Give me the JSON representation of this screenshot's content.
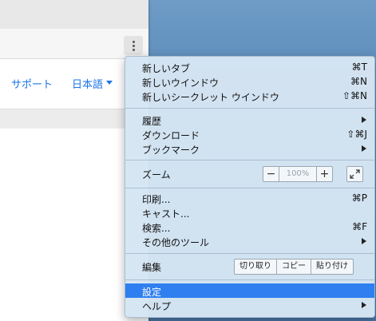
{
  "browser": {
    "nav_links": {
      "support": "サポート",
      "language": "日本語"
    }
  },
  "menu": {
    "group1": [
      {
        "label": "新しいタブ",
        "shortcut": "⌘T"
      },
      {
        "label": "新しいウインドウ",
        "shortcut": "⌘N"
      },
      {
        "label": "新しいシークレット ウインドウ",
        "shortcut": "⇧⌘N"
      }
    ],
    "group2": [
      {
        "label": "履歴",
        "shortcut": ""
      },
      {
        "label": "ダウンロード",
        "shortcut": "⇧⌘J"
      },
      {
        "label": "ブックマーク",
        "shortcut": ""
      }
    ],
    "zoom": {
      "label": "ズーム",
      "minus": "−",
      "value": "100%",
      "plus": "+"
    },
    "group3": [
      {
        "label": "印刷...",
        "shortcut": "⌘P"
      },
      {
        "label": "キャスト...",
        "shortcut": ""
      },
      {
        "label": "検索...",
        "shortcut": "⌘F"
      },
      {
        "label": "その他のツール",
        "shortcut": ""
      }
    ],
    "edit": {
      "label": "編集",
      "cut": "切り取り",
      "copy": "コピー",
      "paste": "貼り付け"
    },
    "settings": "設定",
    "help": "ヘルプ",
    "highlighted_item": "設定",
    "accent_color": "#2f7ff0"
  }
}
